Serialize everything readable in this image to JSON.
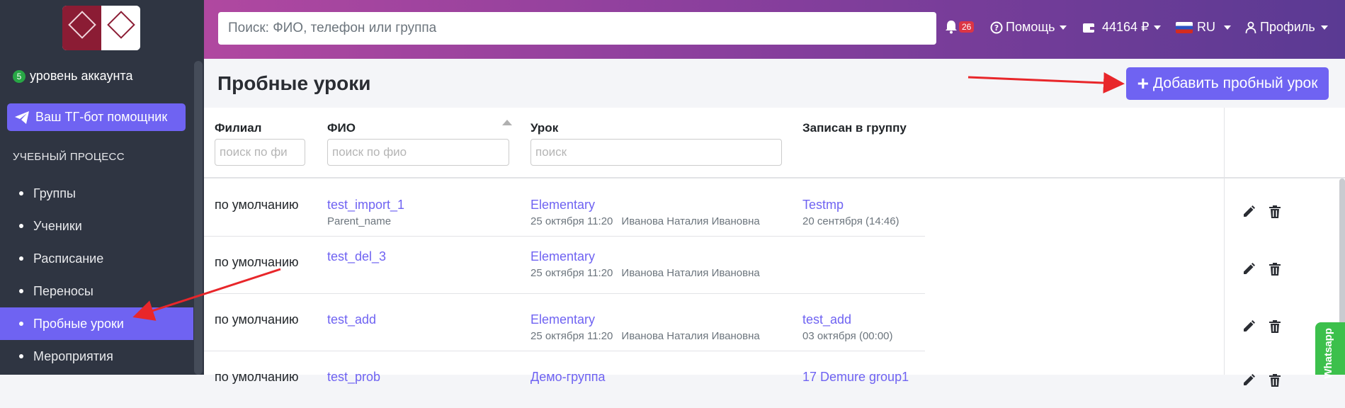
{
  "sidebar": {
    "account_level_badge": "5",
    "account_level_label": "уровень аккаунта",
    "tg_bot_label": "Ваш ТГ-бот помощник",
    "section_title": "УЧЕБНЫЙ ПРОЦЕСС",
    "items": [
      {
        "label": "Группы",
        "active": false
      },
      {
        "label": "Ученики",
        "active": false
      },
      {
        "label": "Расписание",
        "active": false
      },
      {
        "label": "Переносы",
        "active": false
      },
      {
        "label": "Пробные уроки",
        "active": true
      },
      {
        "label": "Мероприятия",
        "active": false
      }
    ]
  },
  "topbar": {
    "search_placeholder": "Поиск: ФИО, телефон или группа",
    "notifications_count": "26",
    "help_label": "Помощь",
    "balance": "44164 ₽",
    "language": "RU",
    "profile_label": "Профиль"
  },
  "page": {
    "title": "Пробные уроки",
    "add_button_label": "Добавить пробный урок"
  },
  "table": {
    "columns": {
      "branch": "Филиал",
      "fio": "ФИО",
      "lesson": "Урок",
      "group": "Записан в группу"
    },
    "filters": {
      "branch_placeholder": "поиск по фи",
      "fio_placeholder": "поиск по фио",
      "lesson_placeholder": "поиск"
    },
    "rows": [
      {
        "branch": "по умолчанию",
        "fio": "test_import_1",
        "fio_sub": "Parent_name",
        "lesson": "Elementary",
        "lesson_date": "25 октября 11:20",
        "teacher": "Иванова Наталия Ивановна",
        "group": "Testmp",
        "group_date": "20 сентября (14:46)"
      },
      {
        "branch": "по умолчанию",
        "fio": "test_del_3",
        "fio_sub": "",
        "lesson": "Elementary",
        "lesson_date": "25 октября 11:20",
        "teacher": "Иванова Наталия Ивановна",
        "group": "",
        "group_date": ""
      },
      {
        "branch": "по умолчанию",
        "fio": "test_add",
        "fio_sub": "",
        "lesson": "Elementary",
        "lesson_date": "25 октября 11:20",
        "teacher": "Иванова Наталия Ивановна",
        "group": "test_add",
        "group_date": "03 октября (00:00)"
      },
      {
        "branch": "по умолчанию",
        "fio": "test_prob",
        "fio_sub": "",
        "lesson": "Демо-группа",
        "lesson_date": "",
        "teacher": "",
        "group": "17 Demure group1",
        "group_date": ""
      }
    ]
  },
  "widget": {
    "whatsapp_label": "Whatsapp"
  },
  "colors": {
    "accent": "#6f63f2",
    "sidebar_bg": "#2f3542",
    "annotation_arrow": "#e8262a"
  }
}
